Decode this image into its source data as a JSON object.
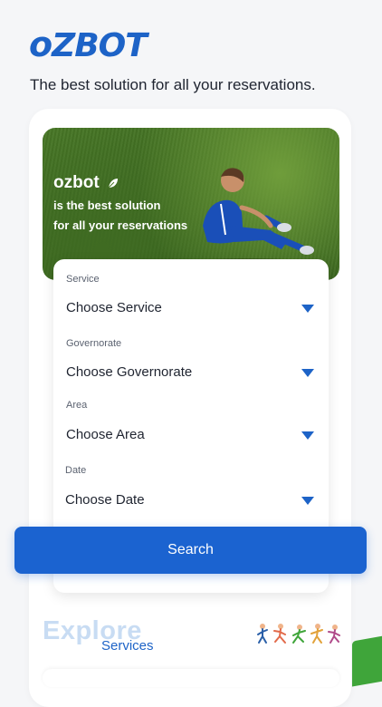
{
  "brand": {
    "logo_text": "OZBOT",
    "accent": "#1d63c7"
  },
  "tagline": "The best solution for all your reservations.",
  "hero": {
    "title": "ozbot",
    "line1": "is the best solution",
    "line2": "for all your reservations"
  },
  "form": {
    "service": {
      "label": "Service",
      "value": "Choose Service"
    },
    "governorate": {
      "label": "Governorate",
      "value": "Choose Governorate"
    },
    "area": {
      "label": "Area",
      "value": "Choose Area"
    },
    "date": {
      "label": "Date",
      "value": "Choose Date"
    }
  },
  "search_button": "Search",
  "explore": {
    "title": "Explore",
    "subtitle": "Services"
  },
  "icons": {
    "hero_icon": "leaf-icon",
    "dropdown_icon": "caret-down-icon",
    "illustration": "people-exercising-icon"
  }
}
